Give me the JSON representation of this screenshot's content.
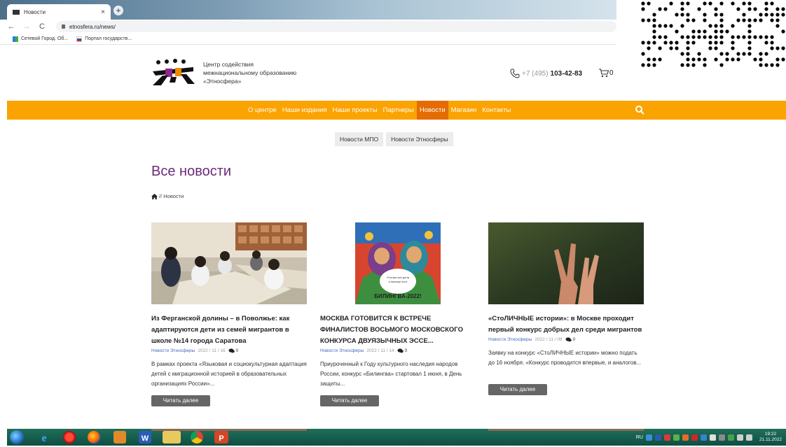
{
  "browser": {
    "tab_title": "Новости",
    "tab_close": "×",
    "new_tab": "+",
    "url": "etnosfera.ru/news/",
    "bookmarks": [
      "Сетевой Город. Об...",
      "Портал государств..."
    ]
  },
  "site": {
    "org_line1": "Центр содействия",
    "org_line2": "межнациональному образованию",
    "org_line3": "«Этносфера»",
    "phone_code": "+7 (495)",
    "phone_number": "103-42-83",
    "cart_count": "0",
    "accent": "#fba300",
    "accent_active": "#e46c02",
    "title_color": "#6a2a7a"
  },
  "menu": [
    "О центре",
    "Наши издания",
    "Наши проекты",
    "Партнеры",
    "Новости",
    "Магазин",
    "Контакты"
  ],
  "subtabs": [
    "Новости МПО",
    "Новости Этносферы"
  ],
  "page": {
    "title": "Все новости",
    "breadcrumb": "// Новости"
  },
  "cards": [
    {
      "title": "Из Ферганской долины – в Поволжье: как адаптируются дети из семей мигрантов в школе №14 города Саратова",
      "category": "Новости Этносферы",
      "date": "2022 / 11 / 16",
      "comments": "0",
      "excerpt": "В рамках проекта «Языковая и социокультурная адаптация детей с миграционной историей в образовательных организациях России»...",
      "button": "Читать далее"
    },
    {
      "title": "МОСКВА ГОТОВИТСЯ К ВСТРЕЧЕ ФИНАЛИСТОВ ВОСЬМОГО МОСКОВСКОГО КОНКУРСА ДВУЯЗЫЧНЫХ ЭССЕ...",
      "category": "Новости Этносферы",
      "date": "2022 / 11 / 14",
      "comments": "0",
      "excerpt": "Приуроченный к Году культурного наследия народов России, конкурс «Билингва» стартовал 1 июня, в День защиты...",
      "button": "Читать далее",
      "poster_text": "БИЛИНГВА-2022!"
    },
    {
      "title": "«СтоЛИЧНЫЕ истории»: в Москве проходит первый конкурс добрых дел среди мигрантов",
      "category": "Новости Этносферы",
      "date": "2022 / 11 / 08",
      "comments": "0",
      "excerpt": "Заявку на конкурс «СтоЛИЧНЫЕ истории» можно подать до 16 ноября. «Конкурс проводится впервые, и аналогов...",
      "button": "Читать далее"
    }
  ],
  "taskbar": {
    "lang": "RU",
    "time": "19:22",
    "date": "21.11.2022"
  }
}
